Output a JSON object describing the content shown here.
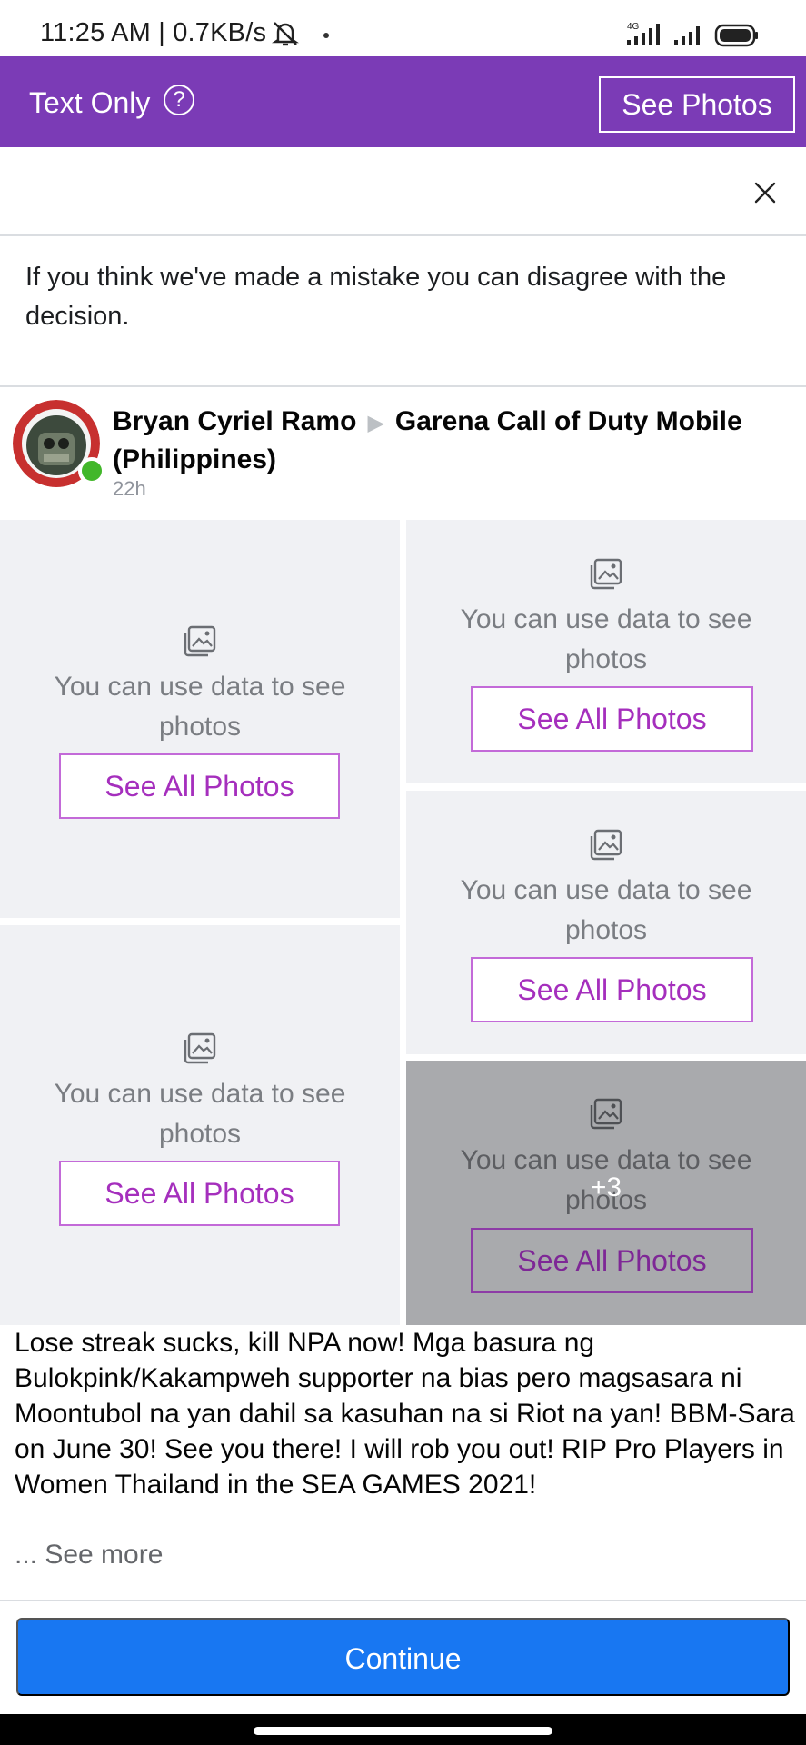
{
  "status_bar": {
    "time": "11:25 AM | 0.7KB/s",
    "network": "4G"
  },
  "header": {
    "mode_label": "Text Only",
    "help_glyph": "?",
    "see_photos_label": "See Photos",
    "background_color": "#7b3bb6"
  },
  "notice": {
    "text": "If you think we've made a mistake you can disagree with the decision."
  },
  "post": {
    "author": "Bryan Cyriel Ramo",
    "target": "Garena Call of Duty Mobile (Philippines)",
    "time": "22h",
    "text": "Lose streak sucks, kill NPA now! Mga basura ng Bulokpink/Kakampweh supporter na bias pero magsasara ni Moontubol na yan dahil sa kasuhan na si Riot na yan! BBM-Sara on June 30! See you there! I will rob you out! RIP Pro Players in Women Thailand in the SEA GAMES 2021!",
    "see_more": "... See more"
  },
  "photo_tiles": [
    {
      "message": "You can use data to see photos",
      "button": "See All Photos"
    },
    {
      "message": "You can use data to see photos",
      "button": "See All Photos"
    },
    {
      "message": "You can use data to see photos",
      "button": "See All Photos"
    },
    {
      "message": "You can use data to see photos",
      "button": "See All Photos"
    },
    {
      "message": "You can use data to see photos",
      "button": "See All Photos",
      "overlay": "+3"
    }
  ],
  "footer": {
    "continue_label": "Continue",
    "accent_color": "#1877f2"
  }
}
